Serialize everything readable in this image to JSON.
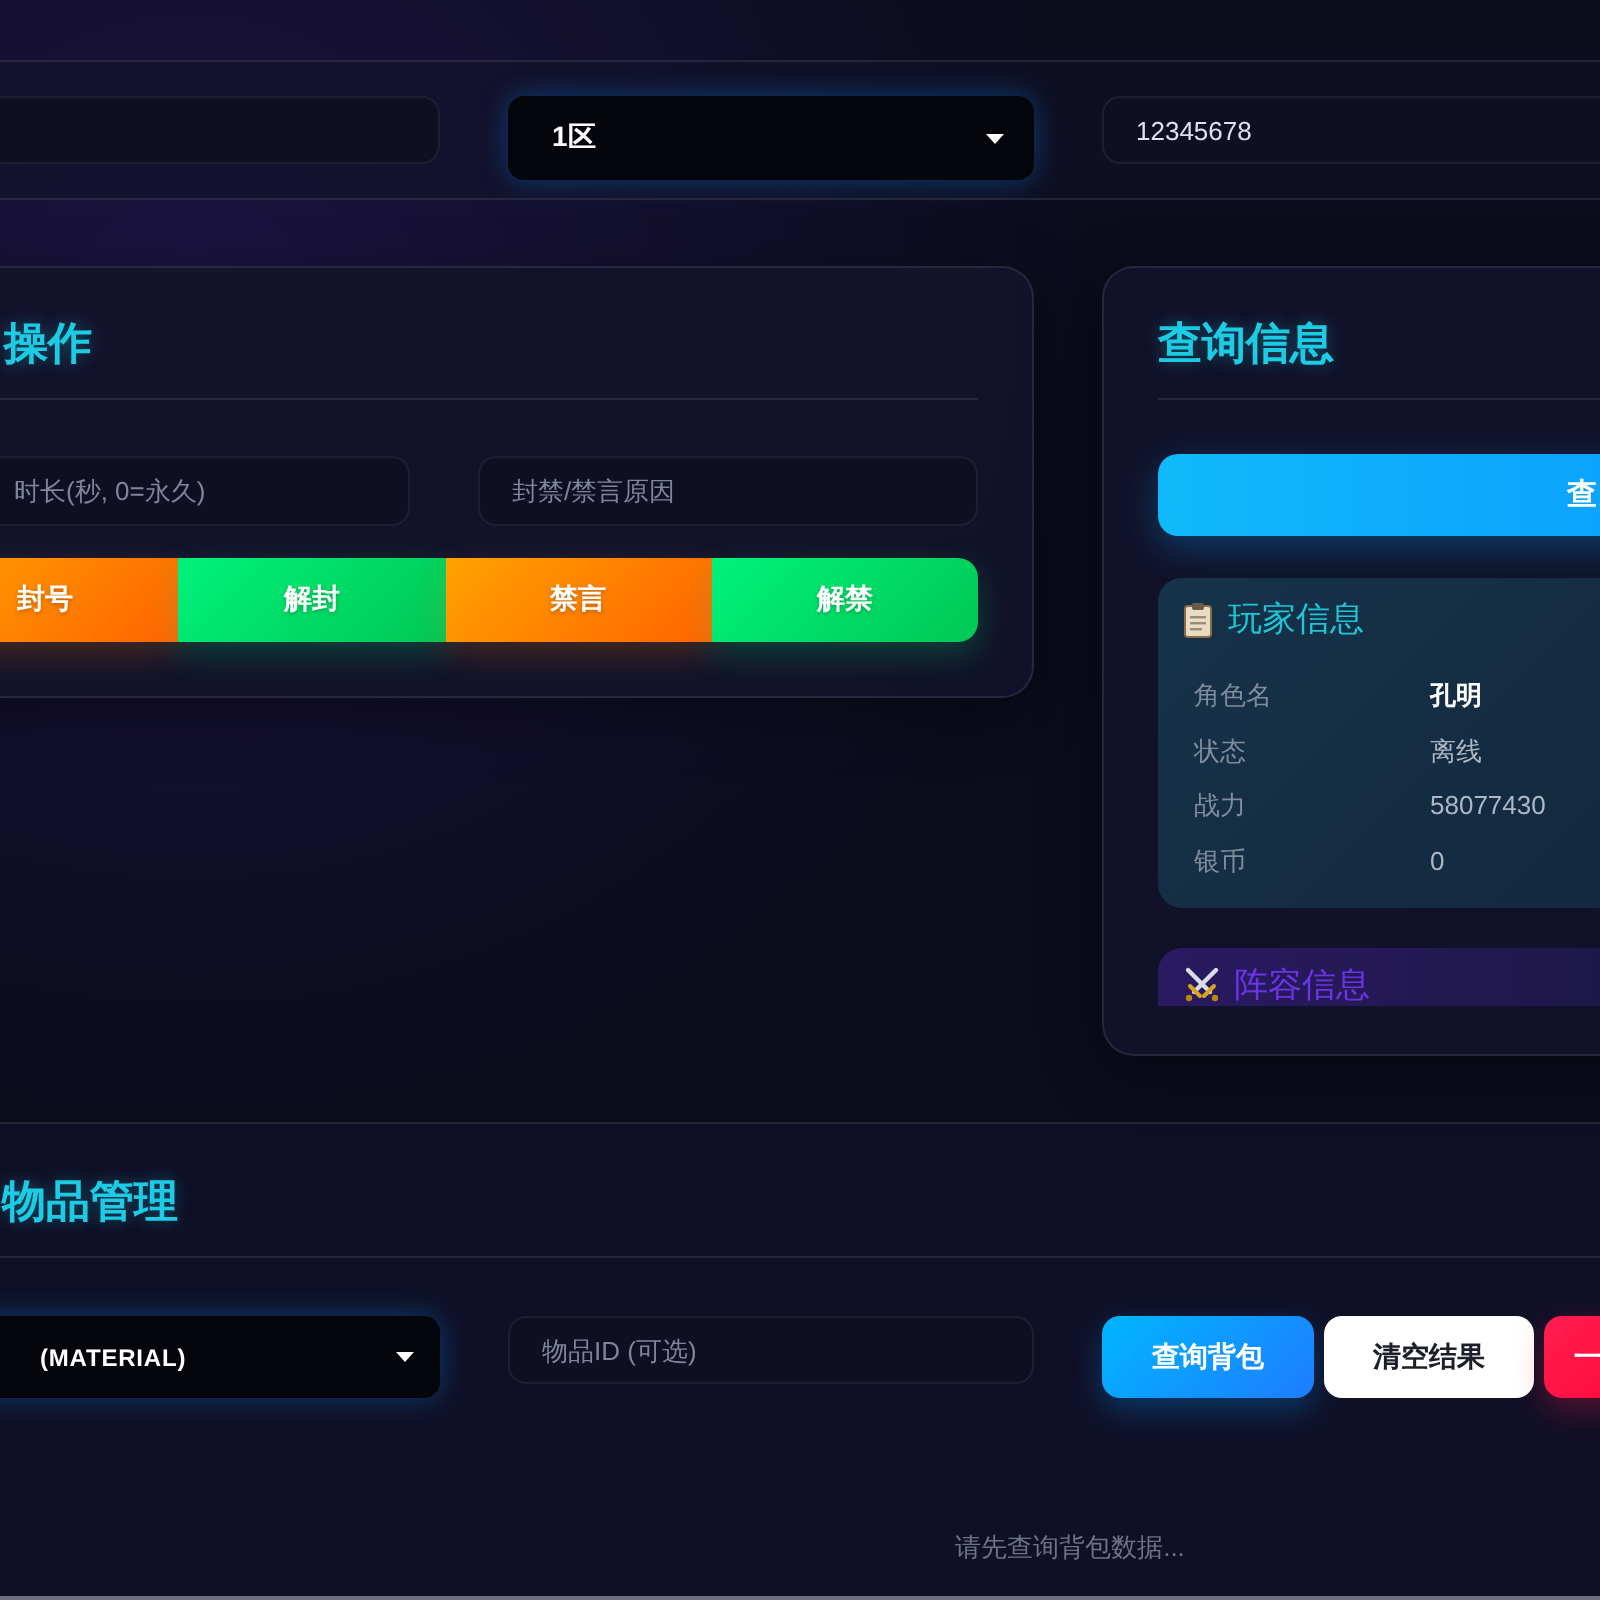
{
  "filter_bar": {
    "fields": [
      {
        "kind": "input"
      },
      {
        "kind": "select",
        "value": "1区"
      },
      {
        "kind": "input",
        "value": "12345678"
      }
    ]
  },
  "action_card": {
    "title": "操作",
    "inputs": [
      {
        "placeholder": "时长(秒, 0=永久)"
      },
      {
        "placeholder": "封禁/禁言原因"
      }
    ],
    "buttons": [
      {
        "label": "封号",
        "kind": "restrict"
      },
      {
        "label": "解封",
        "kind": "restore"
      },
      {
        "label": "禁言",
        "kind": "restrict"
      },
      {
        "label": "解禁",
        "kind": "restore"
      }
    ]
  },
  "query_card": {
    "title": "查询信息",
    "query_button": "查",
    "player_info": {
      "title": "玩家信息",
      "rows": [
        {
          "label": "角色名",
          "value": "孔明",
          "bold": true
        },
        {
          "label": "状态",
          "value": "离线",
          "bold": false
        },
        {
          "label": "战力",
          "value": "58077430",
          "bold": false
        },
        {
          "label": "银币",
          "value": "0",
          "bold": false
        }
      ]
    },
    "lineup": {
      "title": "阵容信息"
    }
  },
  "items_section": {
    "title": "物品管理",
    "type_select": {
      "value": "(MATERIAL)"
    },
    "item_id": {
      "placeholder": "物品ID (可选)"
    },
    "buttons": [
      {
        "label": "查询背包",
        "kind": "primary"
      },
      {
        "label": "清空结果",
        "kind": "plain"
      },
      {
        "label": "一",
        "kind": "danger"
      }
    ],
    "empty_message": "请先查询背包数据..."
  }
}
